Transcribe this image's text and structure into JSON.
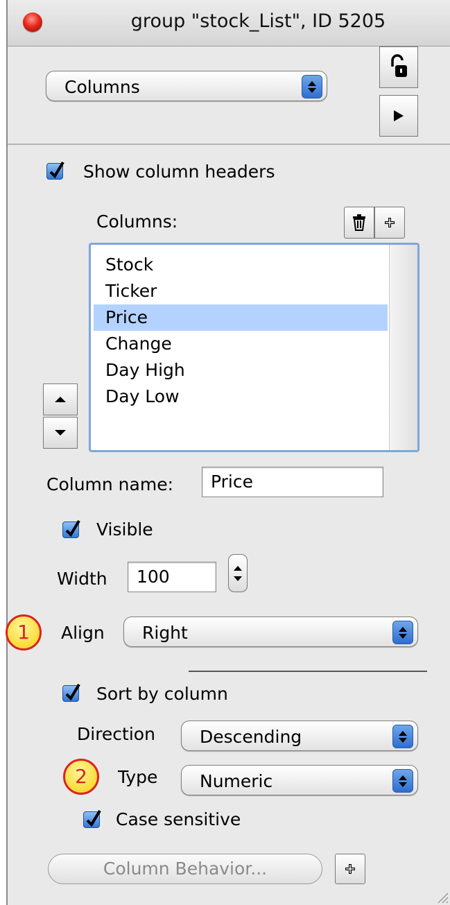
{
  "window": {
    "title": "group \"stock_List\", ID 5205"
  },
  "header": {
    "section_popup": "Columns"
  },
  "show_headers_label": "Show column headers",
  "columns_label": "Columns:",
  "columns_list": [
    "Stock",
    "Ticker",
    "Price",
    "Change",
    "Day High",
    "Day Low"
  ],
  "selected_column": "Price",
  "column_name": {
    "label": "Column name:",
    "value": "Price"
  },
  "visible_label": "Visible",
  "width": {
    "label": "Width",
    "value": "100"
  },
  "align": {
    "label": "Align",
    "value": "Right"
  },
  "sort": {
    "label": "Sort by column"
  },
  "direction": {
    "label": "Direction",
    "value": "Descending"
  },
  "type": {
    "label": "Type",
    "value": "Numeric"
  },
  "case_sensitive_label": "Case sensitive",
  "behavior_button": "Column Behavior...",
  "badges": {
    "one": "1",
    "two": "2"
  },
  "colors": {
    "selection": "#b4d2ff",
    "accent": "#3277d6",
    "badge_fill": "#f7d10e",
    "badge_stroke": "#dd2222"
  },
  "icons": [
    "lock-open-icon",
    "play-icon",
    "trash-icon",
    "plus-icon",
    "arrow-up-icon",
    "arrow-down-icon",
    "resize-grip-icon"
  ]
}
